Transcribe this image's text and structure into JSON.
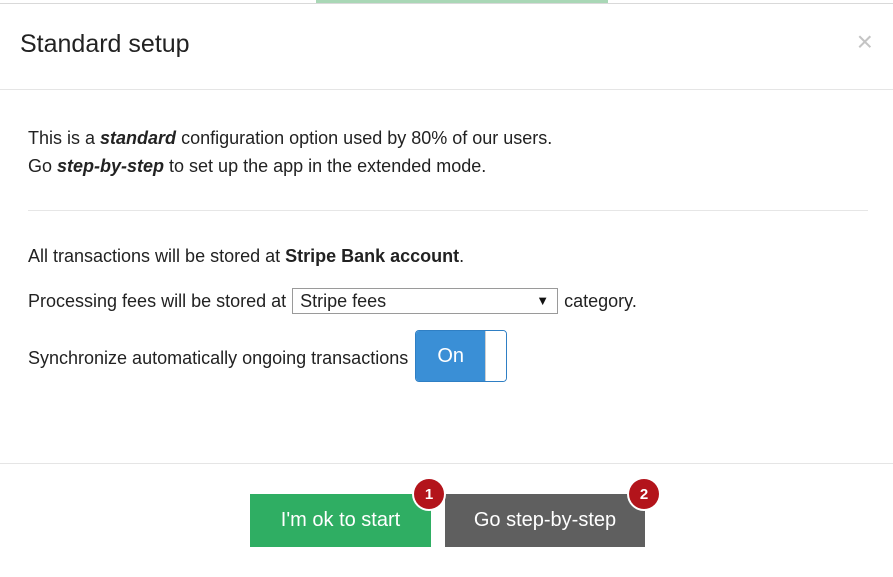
{
  "modal": {
    "title": "Standard setup",
    "close_glyph": "×"
  },
  "intro": {
    "line1_pre": "This is a ",
    "line1_em": "standard",
    "line1_post": " configuration option used by 80% of our users.",
    "line2_pre": "Go ",
    "line2_em": "step-by-step",
    "line2_post": " to set up the app in the extended mode."
  },
  "settings": {
    "transactions_pre": "All transactions will be stored at ",
    "transactions_account": "Stripe Bank account",
    "transactions_post": ".",
    "fees_pre": "Processing fees will be stored at",
    "fees_selected": "Stripe fees",
    "fees_post": "category.",
    "sync_label": "Synchronize automatically ongoing transactions",
    "sync_toggle_label": "On"
  },
  "footer": {
    "start_label": "I'm ok to start",
    "step_label": "Go step-by-step",
    "badge_1": "1",
    "badge_2": "2"
  },
  "colors": {
    "start_button": "#2fae63",
    "step_button": "#5f5f5f",
    "toggle_on": "#3a8fd6",
    "badge": "#b3141b"
  },
  "icons": {
    "close": "close-icon",
    "select_arrow": "chevron-down-icon"
  }
}
